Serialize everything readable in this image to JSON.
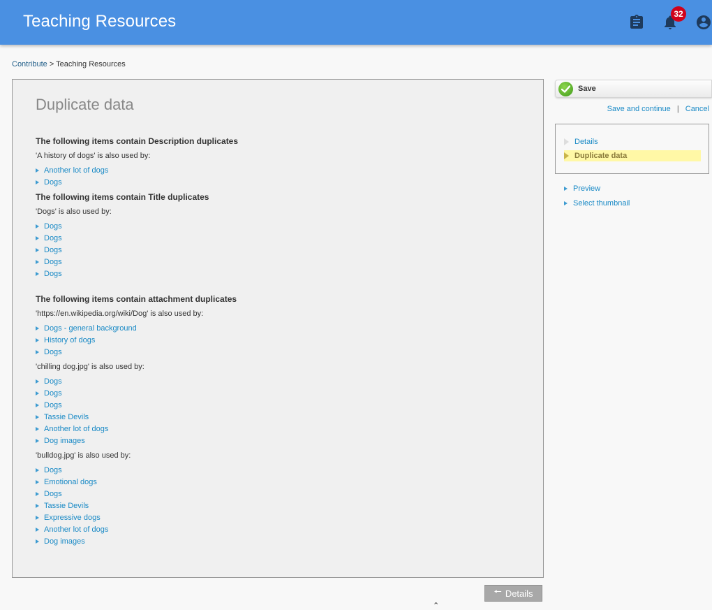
{
  "header": {
    "title": "Teaching Resources",
    "notification_count": "32",
    "icons": [
      "clipboard-icon",
      "bell-icon",
      "account-icon"
    ]
  },
  "breadcrumb": {
    "link": "Contribute",
    "separator": ">",
    "current": "Teaching Resources"
  },
  "main": {
    "title": "Duplicate data",
    "sections": [
      {
        "heading": "The following items contain Description duplicates",
        "groups": [
          {
            "used_by": "'A history of dogs' is also used by:",
            "items": [
              "Another lot of dogs",
              "Dogs"
            ]
          }
        ]
      },
      {
        "heading": "The following items contain Title duplicates",
        "groups": [
          {
            "used_by": "'Dogs' is also used by:",
            "items": [
              "Dogs",
              "Dogs",
              "Dogs",
              "Dogs",
              "Dogs"
            ]
          }
        ]
      },
      {
        "heading": "The following items contain attachment duplicates",
        "groups": [
          {
            "used_by": "'https://en.wikipedia.org/wiki/Dog' is also used by:",
            "items": [
              "Dogs - general background",
              "History of dogs",
              "Dogs"
            ]
          },
          {
            "used_by": "'chilling dog.jpg' is also used by:",
            "items": [
              "Dogs",
              "Dogs",
              "Dogs",
              "Tassie Devils",
              "Another lot of dogs",
              "Dog images"
            ]
          },
          {
            "used_by": "'bulldog.jpg' is also used by:",
            "items": [
              "Dogs",
              "Emotional dogs",
              "Dogs",
              "Tassie Devils",
              "Expressive dogs",
              "Another lot of dogs",
              "Dog images"
            ]
          }
        ]
      }
    ],
    "back_button": {
      "label": "Details",
      "icon": "arrow-left-icon"
    }
  },
  "sidebar": {
    "save_label": "Save",
    "save_and_continue": "Save and continue",
    "link_separator": "|",
    "cancel": "Cancel",
    "steps": [
      {
        "label": "Details",
        "active": false
      },
      {
        "label": "Duplicate data",
        "active": true
      }
    ],
    "links": [
      "Preview",
      "Select thumbnail"
    ]
  },
  "colors": {
    "header_bg": "#4a90e2",
    "link": "#1a8ac6",
    "badge": "#d0021b",
    "active_step_bg": "#fff8a6"
  }
}
